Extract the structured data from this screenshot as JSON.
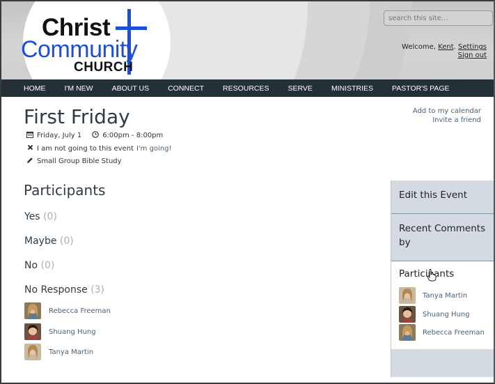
{
  "site": {
    "logo": {
      "line1": "Christ",
      "line2": "Community",
      "line3": "CHURCH"
    },
    "search": {
      "placeholder": "search this site..."
    },
    "user": {
      "welcome_prefix": "Welcome, ",
      "name": "Kent",
      "separator": ". ",
      "settings": "Settings",
      "signout": "Sign out"
    }
  },
  "nav": [
    "HOME",
    "I'M NEW",
    "ABOUT US",
    "CONNECT",
    "RESOURCES",
    "SERVE",
    "MINISTRIES",
    "PASTOR'S PAGE"
  ],
  "event": {
    "title": "First Friday",
    "date": "Friday, July 1",
    "time": "6:00pm - 8:00pm",
    "rsvp_status": "I am not going to this event",
    "rsvp_action": "I'm going!",
    "group": "Small Group Bible Study",
    "add_to_calendar": "Add to my calendar",
    "invite": "Invite a friend"
  },
  "participants": {
    "heading": "Participants",
    "groups": [
      {
        "label": "Yes",
        "count": "(0)"
      },
      {
        "label": "Maybe",
        "count": "(0)"
      },
      {
        "label": "No",
        "count": "(0)"
      },
      {
        "label": "No Response",
        "count": "(3)"
      }
    ],
    "no_response_people": [
      "Rebecca Freeman",
      "Shuang Hung",
      "Tanya Martin"
    ]
  },
  "sidebar": {
    "edit": "Edit this Event",
    "recent": "Recent Comments by",
    "participants_title": "Participants",
    "people": [
      "Tanya Martin",
      "Shuang Hung",
      "Rebecca Freeman"
    ]
  },
  "colors": {
    "nav_bg": "#233036",
    "logo_blue": "#1d4fd6",
    "link": "#4a6076",
    "sidebar_bg": "#d4dae1"
  }
}
